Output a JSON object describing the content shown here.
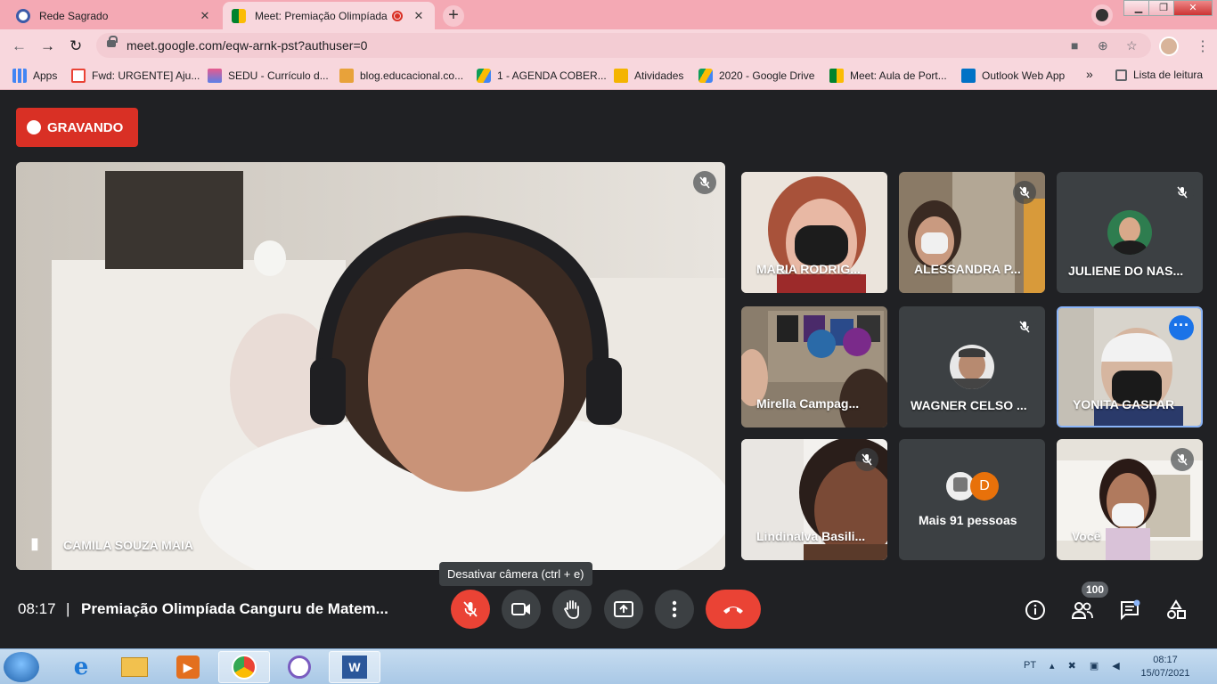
{
  "browser": {
    "tabs": [
      {
        "title": "Rede Sagrado",
        "active": false
      },
      {
        "title": "Meet: Premiação Olimpíada",
        "active": true
      }
    ],
    "url": "meet.google.com/eqw-arnk-pst?authuser=0",
    "bookmarks": [
      {
        "label": "Apps"
      },
      {
        "label": "Fwd: URGENTE] Aju..."
      },
      {
        "label": "SEDU - Currículo d..."
      },
      {
        "label": "blog.educacional.co..."
      },
      {
        "label": "1 - AGENDA COBER..."
      },
      {
        "label": "Atividades"
      },
      {
        "label": "2020 - Google Drive"
      },
      {
        "label": "Meet: Aula de Port..."
      },
      {
        "label": "Outlook Web App"
      },
      {
        "label": "»"
      },
      {
        "label": "Lista de leitura"
      }
    ]
  },
  "meet": {
    "recording_label": "GRAVANDO",
    "main_participant": "CAMILA SOUZA MAIA",
    "participants": [
      {
        "name": "MARIA RODRIG...",
        "muted": false
      },
      {
        "name": "ALESSANDRA P...",
        "muted": true
      },
      {
        "name": "JULIENE DO NAS...",
        "muted": true
      },
      {
        "name": "Mirella Campag...",
        "muted": false
      },
      {
        "name": "WAGNER CELSO ...",
        "muted": true
      },
      {
        "name": "YONITA GASPAR",
        "muted": false
      },
      {
        "name": "Lindinalva Basili...",
        "muted": true
      },
      {
        "name": "Mais 91 pessoas",
        "muted": false,
        "avatar_letter": "D"
      },
      {
        "name": "Você",
        "muted": true
      }
    ],
    "tooltip": "Desativar câmera (ctrl + e)",
    "time": "08:17",
    "separator": "|",
    "meeting_title": "Premiação Olimpíada Canguru de Matem...",
    "people_count": "100",
    "colors": {
      "accent_red": "#ea4335",
      "selected_border": "#8ab4f8",
      "background": "#202124"
    }
  },
  "taskbar": {
    "language": "PT",
    "time": "08:17",
    "date": "15/07/2021"
  }
}
